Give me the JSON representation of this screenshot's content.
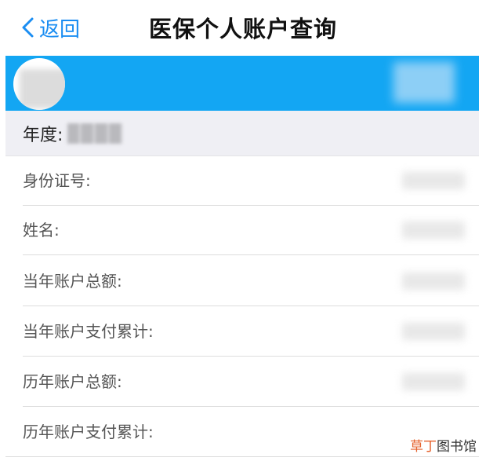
{
  "navbar": {
    "back_label": "返回",
    "title": "医保个人账户查询"
  },
  "year": {
    "label": "年度:"
  },
  "fields": [
    {
      "label": "身份证号:"
    },
    {
      "label": "姓名:"
    },
    {
      "label": "当年账户总额:"
    },
    {
      "label": "当年账户支付累计:"
    },
    {
      "label": "历年账户总额:"
    },
    {
      "label": "历年账户支付累计:"
    }
  ],
  "watermark": {
    "accent": "草丁",
    "rest": "图书馆"
  },
  "colors": {
    "accent": "#1a8df2",
    "banner": "#13a6f3"
  }
}
